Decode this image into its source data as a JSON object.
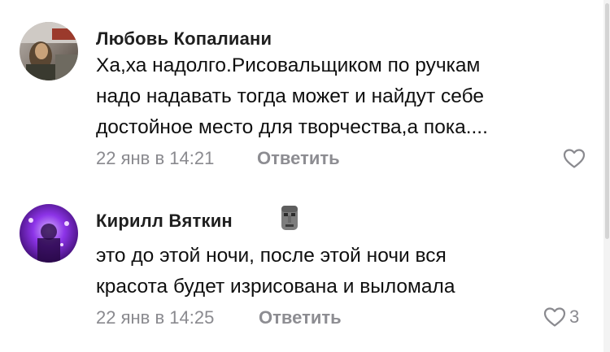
{
  "comments": [
    {
      "author": "Любовь Копалиани",
      "text": "Ха,ха надолго.Рисовальщиком по ручкам\nнадо надавать тогда может и найдут себе\nдостойное место для творчества,а пока....",
      "timestamp": "22 янв в 14:21",
      "reply_label": "Ответить",
      "likes": "",
      "avatar_icon": "user-photo-icon",
      "like_icon": "heart-icon"
    },
    {
      "author": "Кирилл Вяткин",
      "author_emoji": "moai-emoji-icon",
      "text": "это до этой ночи, после этой ночи вся\nкрасота будет изрисована и выломала",
      "timestamp": "22 янв в 14:25",
      "reply_label": "Ответить",
      "likes": "3",
      "avatar_icon": "user-photo-icon",
      "like_icon": "heart-icon"
    }
  ],
  "colors": {
    "meta": "#8a8a8f",
    "author": "#1f1f1f",
    "text": "#0f0f0f"
  }
}
